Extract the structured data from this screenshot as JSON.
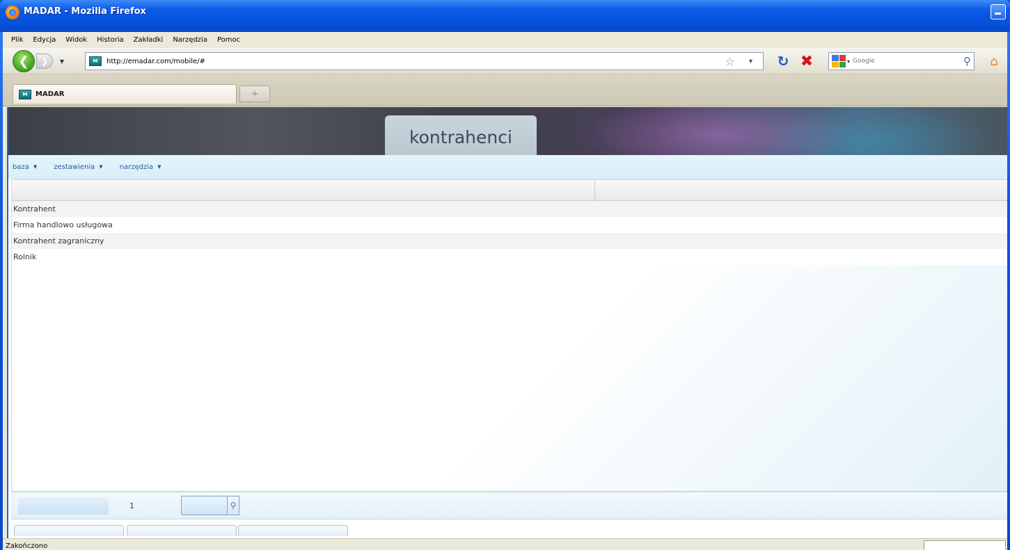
{
  "window": {
    "title": "MADAR - Mozilla Firefox"
  },
  "menubar": {
    "items": [
      "Plik",
      "Edycja",
      "Widok",
      "Historia",
      "Zakładki",
      "Narzędzia",
      "Pomoc"
    ]
  },
  "navbar": {
    "url": "http://emadar.com/mobile/#",
    "site_icon_text": "",
    "search_placeholder": "Google"
  },
  "tabs": {
    "active_label": "MADAR",
    "new_tab_symbol": "+"
  },
  "page": {
    "header_title": "kontrahenci",
    "menu": [
      {
        "label": "baza"
      },
      {
        "label": "zestawienia"
      },
      {
        "label": "narzędzia"
      }
    ],
    "rows": [
      "Kontrahent",
      "Firma handlowo usługowa",
      "Kontrahent zagraniczny",
      "Rolnik"
    ],
    "pager": {
      "page_number": "1"
    }
  },
  "statusbar": {
    "text": "Zakończono"
  },
  "colors": {
    "titlebar": "#0752dd",
    "banner": "#3b3f46",
    "menu_text": "#2a5a94",
    "stop": "#d41414",
    "reload": "#1e59c9"
  },
  "icons": {
    "back": "back-arrow-icon",
    "forward": "forward-arrow-icon",
    "reload": "reload-icon",
    "stop": "stop-icon",
    "home": "home-icon",
    "search": "magnifier-icon",
    "bookmark": "star-icon"
  }
}
